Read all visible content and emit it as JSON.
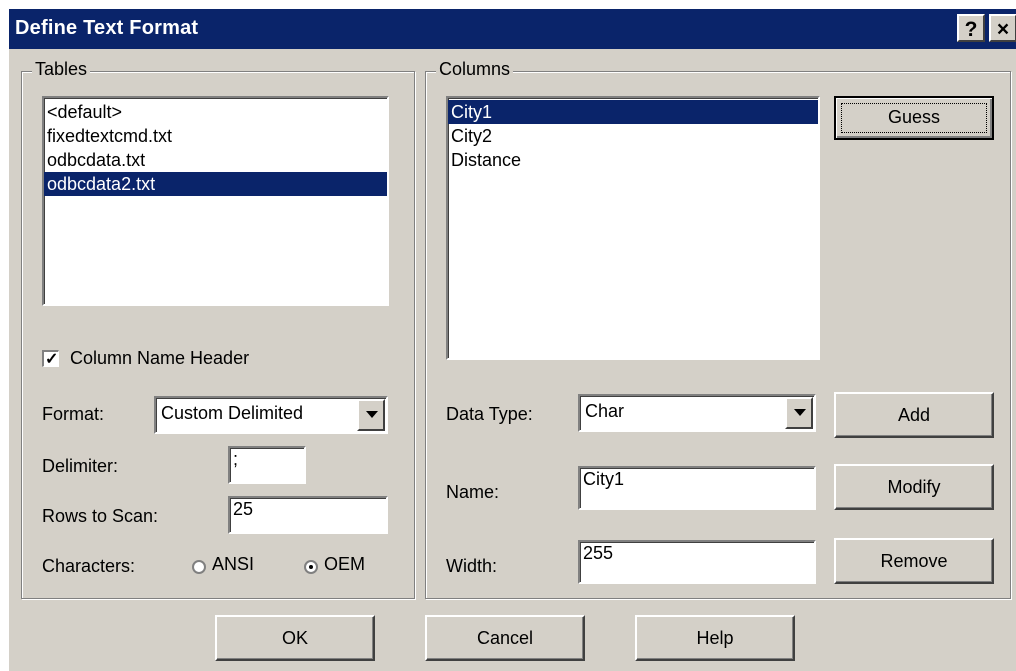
{
  "window": {
    "title": "Define Text Format",
    "help_button": "?",
    "close_button": "×"
  },
  "tables": {
    "legend": "Tables",
    "items": [
      {
        "label": "<default>",
        "selected": false
      },
      {
        "label": "fixedtextcmd.txt",
        "selected": false
      },
      {
        "label": "odbcdata.txt",
        "selected": false
      },
      {
        "label": "odbcdata2.txt",
        "selected": true
      }
    ],
    "column_name_header": {
      "label": "Column Name Header",
      "checked": true
    },
    "format": {
      "label": "Format:",
      "value": "Custom Delimited"
    },
    "delimiter": {
      "label": "Delimiter:",
      "value": ";"
    },
    "rows_to_scan": {
      "label": "Rows to Scan:",
      "value": "25"
    },
    "characters": {
      "label": "Characters:",
      "ansi": "ANSI",
      "oem": "OEM",
      "selected": "OEM"
    }
  },
  "columns": {
    "legend": "Columns",
    "items": [
      {
        "label": "City1",
        "selected": true
      },
      {
        "label": "City2",
        "selected": false
      },
      {
        "label": "Distance",
        "selected": false
      }
    ],
    "guess_button": "Guess",
    "data_type": {
      "label": "Data Type:",
      "value": "Char"
    },
    "name": {
      "label": "Name:",
      "value": "City1"
    },
    "width": {
      "label": "Width:",
      "value": "255"
    },
    "add_button": "Add",
    "modify_button": "Modify",
    "remove_button": "Remove"
  },
  "footer": {
    "ok_button": "OK",
    "cancel_button": "Cancel",
    "help_button": "Help"
  },
  "colors": {
    "title_bar": "#0a246a",
    "dialog_face": "#d4d0c8",
    "selection": "#0a246a"
  }
}
